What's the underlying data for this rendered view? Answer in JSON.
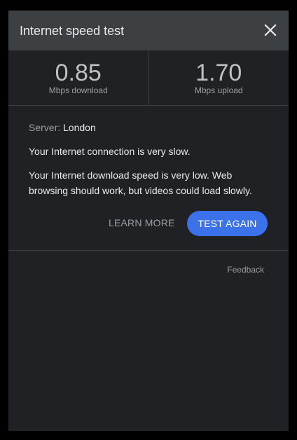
{
  "dialog": {
    "title": "Internet speed test",
    "close_icon": "close-icon"
  },
  "results": {
    "download": {
      "value": "0.85",
      "label": "Mbps download"
    },
    "upload": {
      "value": "1.70",
      "label": "Mbps upload"
    }
  },
  "info": {
    "server_label": "Server: ",
    "server_value": "London",
    "status": "Your Internet connection is very slow.",
    "detail": "Your Internet download speed is very low. Web browsing should work, but videos could load slowly."
  },
  "actions": {
    "learn_more": "LEARN MORE",
    "test_again": "TEST AGAIN"
  },
  "footer": {
    "feedback": "Feedback"
  },
  "colors": {
    "header_bg": "#3c4043",
    "panel_bg": "#202124",
    "accent": "#3b72e9"
  }
}
